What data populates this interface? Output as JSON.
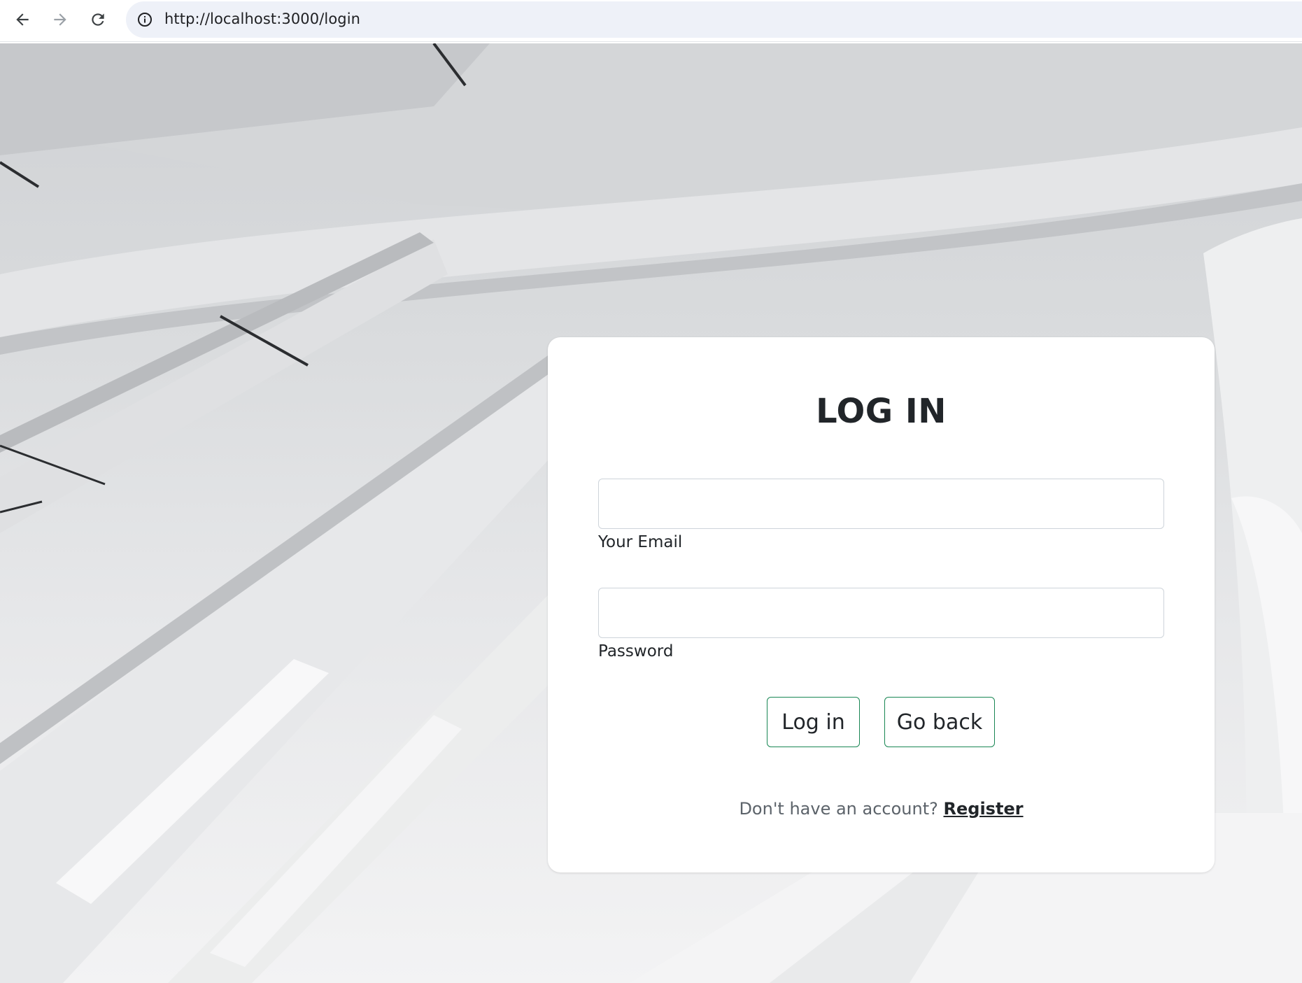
{
  "browser": {
    "url": "http://localhost:3000/login",
    "nav": {
      "back_icon": "arrow-left-icon",
      "forward_icon": "arrow-right-icon",
      "reload_icon": "reload-icon",
      "site_info_icon": "info-circle-icon"
    }
  },
  "login": {
    "title": "LOG IN",
    "email": {
      "label": "Your Email",
      "value": ""
    },
    "password": {
      "label": "Password",
      "value": ""
    },
    "login_button": "Log in",
    "goback_button": "Go back",
    "register_prompt": "Don't have an account?",
    "register_link": "Register"
  },
  "colors": {
    "accent_border": "#198754",
    "text": "#212529",
    "muted_text": "#5c636a",
    "card_bg": "#ffffff"
  }
}
